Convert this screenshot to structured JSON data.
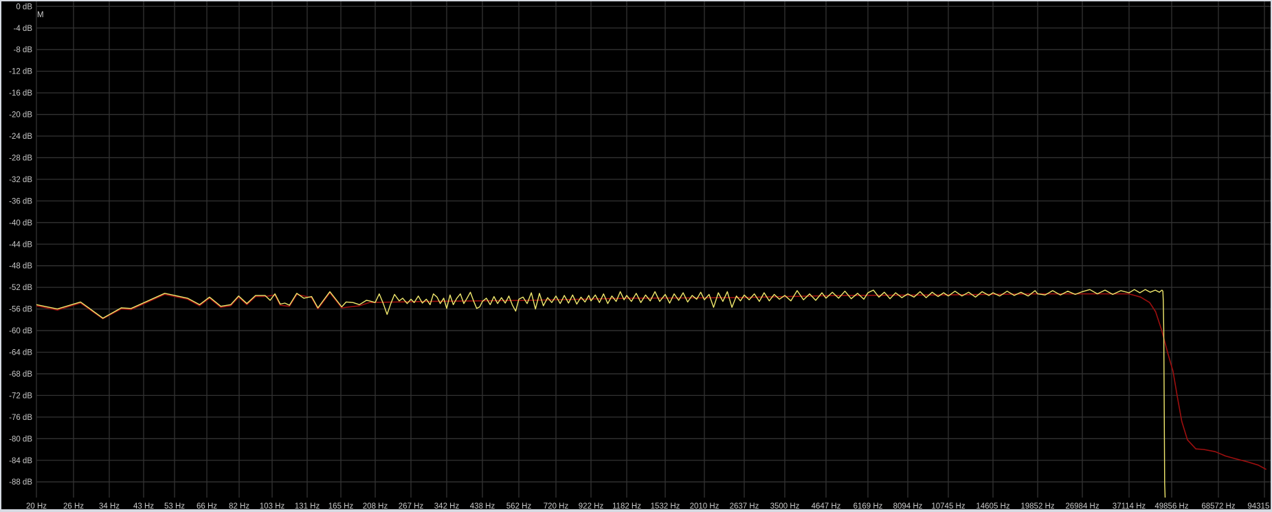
{
  "chart_data": {
    "type": "line",
    "marker_label": "M",
    "x_scale": "log",
    "y_unit": "dB",
    "x_unit": "Hz",
    "grid": true,
    "xlim": [
      20,
      94315
    ],
    "ylim": [
      -91,
      0
    ],
    "y_ticks": [
      "0 dB",
      "-4 dB",
      "-8 dB",
      "-12 dB",
      "-16 dB",
      "-20 dB",
      "-24 dB",
      "-28 dB",
      "-32 dB",
      "-36 dB",
      "-40 dB",
      "-44 dB",
      "-48 dB",
      "-52 dB",
      "-56 dB",
      "-60 dB",
      "-64 dB",
      "-68 dB",
      "-72 dB",
      "-76 dB",
      "-80 dB",
      "-84 dB",
      "-88 dB"
    ],
    "y_tick_values": [
      0,
      -4,
      -8,
      -12,
      -16,
      -20,
      -24,
      -28,
      -32,
      -36,
      -40,
      -44,
      -48,
      -52,
      -56,
      -60,
      -64,
      -68,
      -72,
      -76,
      -80,
      -84,
      -88
    ],
    "x_ticks": [
      "20 Hz",
      "26 Hz",
      "34 Hz",
      "43 Hz",
      "53 Hz",
      "66 Hz",
      "82 Hz",
      "103 Hz",
      "131 Hz",
      "165 Hz",
      "208 Hz",
      "267 Hz",
      "342 Hz",
      "438 Hz",
      "562 Hz",
      "720 Hz",
      "922 Hz",
      "1182 Hz",
      "1532 Hz",
      "2010 Hz",
      "2637 Hz",
      "3500 Hz",
      "4647 Hz",
      "6169 Hz",
      "8094 Hz",
      "10745 Hz",
      "14605 Hz",
      "19852 Hz",
      "26984 Hz",
      "37114 Hz",
      "49856 Hz",
      "68572 Hz",
      "94315 Hz"
    ],
    "x_tick_values": [
      20,
      26,
      34,
      43,
      53,
      66,
      82,
      103,
      131,
      165,
      208,
      267,
      342,
      438,
      562,
      720,
      922,
      1182,
      1532,
      2010,
      2637,
      3500,
      4647,
      6169,
      8094,
      10745,
      14605,
      19852,
      26984,
      37114,
      49856,
      68572,
      94315
    ],
    "series": [
      {
        "color": "#9e0f0f",
        "points": [
          [
            20,
            -55.4
          ],
          [
            23.2,
            -56.2
          ],
          [
            27.4,
            -54.9
          ],
          [
            32.4,
            -57.8
          ],
          [
            36.9,
            -56.0
          ],
          [
            39.5,
            -56.1
          ],
          [
            49.6,
            -53.3
          ],
          [
            57.9,
            -54.2
          ],
          [
            62.8,
            -55.4
          ],
          [
            67.2,
            -54.0
          ],
          [
            72.5,
            -55.7
          ],
          [
            77.5,
            -55.4
          ],
          [
            81.7,
            -53.8
          ],
          [
            86.5,
            -55.2
          ],
          [
            91.9,
            -53.7
          ],
          [
            98.1,
            -53.7
          ],
          [
            105,
            -53.4
          ],
          [
            108.9,
            -55.3
          ],
          [
            116,
            -55.5
          ],
          [
            122,
            -53.3
          ],
          [
            135,
            -53.9
          ],
          [
            141,
            -56.0
          ],
          [
            153,
            -53.0
          ],
          [
            166,
            -55.8
          ],
          [
            187,
            -55.4
          ],
          [
            200,
            -54.8
          ],
          [
            300,
            -54.6
          ],
          [
            600,
            -54.4
          ],
          [
            1200,
            -54.0
          ],
          [
            2500,
            -53.9
          ],
          [
            5000,
            -53.5
          ],
          [
            10000,
            -53.4
          ],
          [
            20000,
            -53.2
          ],
          [
            37114,
            -53.2
          ],
          [
            40200,
            -53.8
          ],
          [
            42800,
            -54.8
          ],
          [
            44600,
            -56.5
          ],
          [
            46500,
            -59.9
          ],
          [
            48500,
            -64.1
          ],
          [
            50300,
            -67.5
          ],
          [
            51800,
            -72.2
          ],
          [
            53400,
            -76.8
          ],
          [
            55500,
            -80.2
          ],
          [
            58800,
            -81.9
          ],
          [
            62000,
            -82.0
          ],
          [
            67100,
            -82.4
          ],
          [
            72000,
            -83.2
          ],
          [
            77000,
            -83.7
          ],
          [
            84000,
            -84.3
          ],
          [
            90400,
            -84.9
          ],
          [
            95500,
            -85.7
          ]
        ]
      },
      {
        "color": "#f2ea6e",
        "points": [
          [
            20,
            -55.2
          ],
          [
            23.2,
            -56.0
          ],
          [
            27.4,
            -54.7
          ],
          [
            32.4,
            -57.7
          ],
          [
            36.9,
            -55.8
          ],
          [
            39.5,
            -55.9
          ],
          [
            49.6,
            -53.1
          ],
          [
            57.9,
            -54.0
          ],
          [
            62.8,
            -55.2
          ],
          [
            67.2,
            -53.8
          ],
          [
            72.5,
            -55.5
          ],
          [
            77.5,
            -55.2
          ],
          [
            81.7,
            -53.6
          ],
          [
            86.5,
            -55.0
          ],
          [
            91.9,
            -53.5
          ],
          [
            98.1,
            -53.5
          ],
          [
            101.6,
            -54.4
          ],
          [
            105,
            -53.2
          ],
          [
            108.9,
            -55.1
          ],
          [
            112.4,
            -54.9
          ],
          [
            116,
            -55.3
          ],
          [
            122,
            -53.1
          ],
          [
            128,
            -54.0
          ],
          [
            135,
            -53.7
          ],
          [
            141,
            -55.8
          ],
          [
            153,
            -52.8
          ],
          [
            166,
            -55.6
          ],
          [
            171,
            -54.7
          ],
          [
            179,
            -54.8
          ],
          [
            187,
            -55.2
          ],
          [
            196,
            -54.4
          ],
          [
            200,
            -54.5
          ],
          [
            208,
            -54.8
          ],
          [
            214,
            -53.2
          ],
          [
            220,
            -55.0
          ],
          [
            226,
            -57.0
          ],
          [
            232,
            -55.0
          ],
          [
            238,
            -53.3
          ],
          [
            246,
            -54.5
          ],
          [
            252,
            -54.0
          ],
          [
            260,
            -55.0
          ],
          [
            267,
            -54.2
          ],
          [
            273,
            -54.8
          ],
          [
            281,
            -53.6
          ],
          [
            289,
            -54.9
          ],
          [
            297,
            -54.2
          ],
          [
            305,
            -55.2
          ],
          [
            312,
            -53.2
          ],
          [
            320,
            -53.8
          ],
          [
            327,
            -55.0
          ],
          [
            335,
            -54.0
          ],
          [
            342,
            -55.9
          ],
          [
            350,
            -53.4
          ],
          [
            358,
            -55.2
          ],
          [
            367,
            -54.0
          ],
          [
            376,
            -53.2
          ],
          [
            385,
            -55.0
          ],
          [
            394,
            -54.0
          ],
          [
            403,
            -52.9
          ],
          [
            412,
            -54.5
          ],
          [
            421,
            -55.9
          ],
          [
            430,
            -55.6
          ],
          [
            438,
            -54.6
          ],
          [
            450,
            -54.0
          ],
          [
            462,
            -55.2
          ],
          [
            474,
            -53.7
          ],
          [
            486,
            -55.0
          ],
          [
            499,
            -53.9
          ],
          [
            512,
            -54.9
          ],
          [
            525,
            -53.6
          ],
          [
            538,
            -55.3
          ],
          [
            550,
            -56.4
          ],
          [
            562,
            -54.2
          ],
          [
            578,
            -53.8
          ],
          [
            594,
            -55.0
          ],
          [
            611,
            -53.0
          ],
          [
            628,
            -56.0
          ],
          [
            645,
            -53.1
          ],
          [
            662,
            -55.4
          ],
          [
            681,
            -53.9
          ],
          [
            700,
            -54.8
          ],
          [
            720,
            -53.6
          ],
          [
            742,
            -55.0
          ],
          [
            764,
            -53.5
          ],
          [
            787,
            -54.9
          ],
          [
            810,
            -53.4
          ],
          [
            834,
            -55.1
          ],
          [
            859,
            -53.8
          ],
          [
            884,
            -54.7
          ],
          [
            908,
            -53.5
          ],
          [
            922,
            -54.5
          ],
          [
            950,
            -53.4
          ],
          [
            978,
            -54.8
          ],
          [
            1006,
            -53.2
          ],
          [
            1036,
            -55.0
          ],
          [
            1066,
            -53.6
          ],
          [
            1098,
            -54.6
          ],
          [
            1130,
            -52.8
          ],
          [
            1160,
            -54.3
          ],
          [
            1182,
            -53.5
          ],
          [
            1220,
            -54.6
          ],
          [
            1260,
            -53.1
          ],
          [
            1300,
            -54.8
          ],
          [
            1342,
            -53.4
          ],
          [
            1385,
            -54.5
          ],
          [
            1430,
            -52.8
          ],
          [
            1476,
            -54.6
          ],
          [
            1532,
            -53.3
          ],
          [
            1580,
            -54.9
          ],
          [
            1630,
            -53.2
          ],
          [
            1682,
            -54.4
          ],
          [
            1735,
            -53.0
          ],
          [
            1790,
            -54.7
          ],
          [
            1847,
            -53.5
          ],
          [
            1906,
            -54.2
          ],
          [
            1960,
            -52.9
          ],
          [
            2010,
            -54.3
          ],
          [
            2075,
            -53.3
          ],
          [
            2140,
            -55.7
          ],
          [
            2210,
            -53.0
          ],
          [
            2280,
            -54.6
          ],
          [
            2350,
            -52.8
          ],
          [
            2425,
            -55.7
          ],
          [
            2500,
            -53.6
          ],
          [
            2570,
            -54.5
          ],
          [
            2637,
            -53.4
          ],
          [
            2730,
            -54.3
          ],
          [
            2830,
            -53.2
          ],
          [
            2930,
            -54.6
          ],
          [
            3030,
            -53.0
          ],
          [
            3140,
            -54.5
          ],
          [
            3250,
            -53.3
          ],
          [
            3370,
            -54.2
          ],
          [
            3500,
            -53.5
          ],
          [
            3650,
            -54.5
          ],
          [
            3810,
            -52.6
          ],
          [
            3980,
            -54.3
          ],
          [
            4150,
            -53.2
          ],
          [
            4330,
            -54.4
          ],
          [
            4520,
            -53.0
          ],
          [
            4647,
            -54.0
          ],
          [
            4850,
            -52.9
          ],
          [
            5060,
            -54.0
          ],
          [
            5280,
            -52.7
          ],
          [
            5510,
            -54.1
          ],
          [
            5750,
            -53.1
          ],
          [
            6000,
            -54.2
          ],
          [
            6169,
            -53.0
          ],
          [
            6400,
            -52.5
          ],
          [
            6650,
            -53.8
          ],
          [
            6900,
            -52.9
          ],
          [
            7170,
            -54.1
          ],
          [
            7450,
            -53.0
          ],
          [
            7770,
            -53.9
          ],
          [
            8094,
            -53.2
          ],
          [
            8450,
            -53.8
          ],
          [
            8820,
            -52.8
          ],
          [
            9200,
            -53.9
          ],
          [
            9600,
            -52.9
          ],
          [
            10000,
            -53.7
          ],
          [
            10400,
            -53.0
          ],
          [
            10745,
            -53.6
          ],
          [
            11250,
            -52.7
          ],
          [
            11800,
            -53.6
          ],
          [
            12350,
            -52.9
          ],
          [
            12950,
            -53.8
          ],
          [
            13550,
            -52.8
          ],
          [
            14200,
            -53.5
          ],
          [
            14605,
            -53.0
          ],
          [
            15300,
            -53.6
          ],
          [
            16100,
            -52.7
          ],
          [
            16900,
            -53.5
          ],
          [
            17700,
            -52.9
          ],
          [
            18600,
            -53.6
          ],
          [
            19500,
            -52.6
          ],
          [
            19852,
            -53.2
          ],
          [
            20900,
            -53.4
          ],
          [
            22000,
            -52.6
          ],
          [
            23200,
            -53.4
          ],
          [
            24400,
            -52.7
          ],
          [
            25700,
            -53.3
          ],
          [
            26984,
            -52.8
          ],
          [
            28400,
            -52.4
          ],
          [
            29900,
            -53.2
          ],
          [
            31500,
            -52.5
          ],
          [
            33200,
            -53.3
          ],
          [
            35100,
            -52.6
          ],
          [
            37114,
            -53.0
          ],
          [
            38500,
            -52.4
          ],
          [
            40000,
            -53.0
          ],
          [
            41500,
            -52.4
          ],
          [
            43000,
            -52.9
          ],
          [
            44500,
            -52.5
          ],
          [
            45800,
            -52.9
          ],
          [
            46600,
            -52.5
          ],
          [
            46900,
            -52.7
          ],
          [
            47050,
            -54.5
          ],
          [
            47200,
            -60.0
          ],
          [
            47350,
            -75.0
          ],
          [
            47500,
            -88.3
          ],
          [
            47650,
            -91.0
          ]
        ]
      }
    ]
  }
}
